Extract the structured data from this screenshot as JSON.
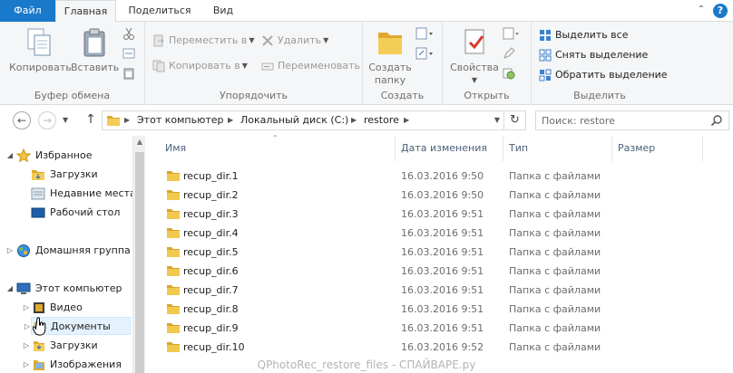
{
  "ribbon_tabs": {
    "file": "Файл",
    "home": "Главная",
    "share": "Поделиться",
    "view": "Вид"
  },
  "ribbon": {
    "clipboard": {
      "title": "Буфер обмена",
      "copy": "Копировать",
      "paste": "Вставить"
    },
    "organize": {
      "title": "Упорядочить",
      "move_to": "Переместить в",
      "copy_to": "Копировать в",
      "delete": "Удалить",
      "rename": "Переименовать"
    },
    "create": {
      "title": "Создать",
      "new_folder_line1": "Создать",
      "new_folder_line2": "папку"
    },
    "open": {
      "title": "Открыть",
      "properties": "Свойства"
    },
    "select": {
      "title": "Выделить",
      "select_all": "Выделить все",
      "select_none": "Снять выделение",
      "invert": "Обратить выделение"
    }
  },
  "address": {
    "crumbs": [
      "Этот компьютер",
      "Локальный диск (C:)",
      "restore"
    ],
    "search_placeholder": "Поиск: restore"
  },
  "nav_tree": {
    "favorites": "Избранное",
    "downloads": "Загрузки",
    "recent": "Недавние места",
    "desktop": "Рабочий стол",
    "homegroup": "Домашняя группа",
    "this_pc": "Этот компьютер",
    "video": "Видео",
    "documents": "Документы",
    "downloads2": "Загрузки",
    "pictures": "Изображения"
  },
  "columns": {
    "name": "Имя",
    "date": "Дата изменения",
    "type": "Тип",
    "size": "Размер"
  },
  "files": [
    {
      "name": "recup_dir.1",
      "date": "16.03.2016 9:50",
      "type": "Папка с файлами"
    },
    {
      "name": "recup_dir.2",
      "date": "16.03.2016 9:50",
      "type": "Папка с файлами"
    },
    {
      "name": "recup_dir.3",
      "date": "16.03.2016 9:51",
      "type": "Папка с файлами"
    },
    {
      "name": "recup_dir.4",
      "date": "16.03.2016 9:51",
      "type": "Папка с файлами"
    },
    {
      "name": "recup_dir.5",
      "date": "16.03.2016 9:51",
      "type": "Папка с файлами"
    },
    {
      "name": "recup_dir.6",
      "date": "16.03.2016 9:51",
      "type": "Папка с файлами"
    },
    {
      "name": "recup_dir.7",
      "date": "16.03.2016 9:51",
      "type": "Папка с файлами"
    },
    {
      "name": "recup_dir.8",
      "date": "16.03.2016 9:51",
      "type": "Папка с файлами"
    },
    {
      "name": "recup_dir.9",
      "date": "16.03.2016 9:51",
      "type": "Папка с файлами"
    },
    {
      "name": "recup_dir.10",
      "date": "16.03.2016 9:52",
      "type": "Папка с файлами"
    }
  ],
  "watermark": "QPhotoRec_restore_files - СПАЙВАРЕ.ру",
  "colors": {
    "file_tab": "#1979ca",
    "folder_yellow": "#e8b94a",
    "header_text": "#4c607a",
    "selection": "#e5f3ff"
  }
}
